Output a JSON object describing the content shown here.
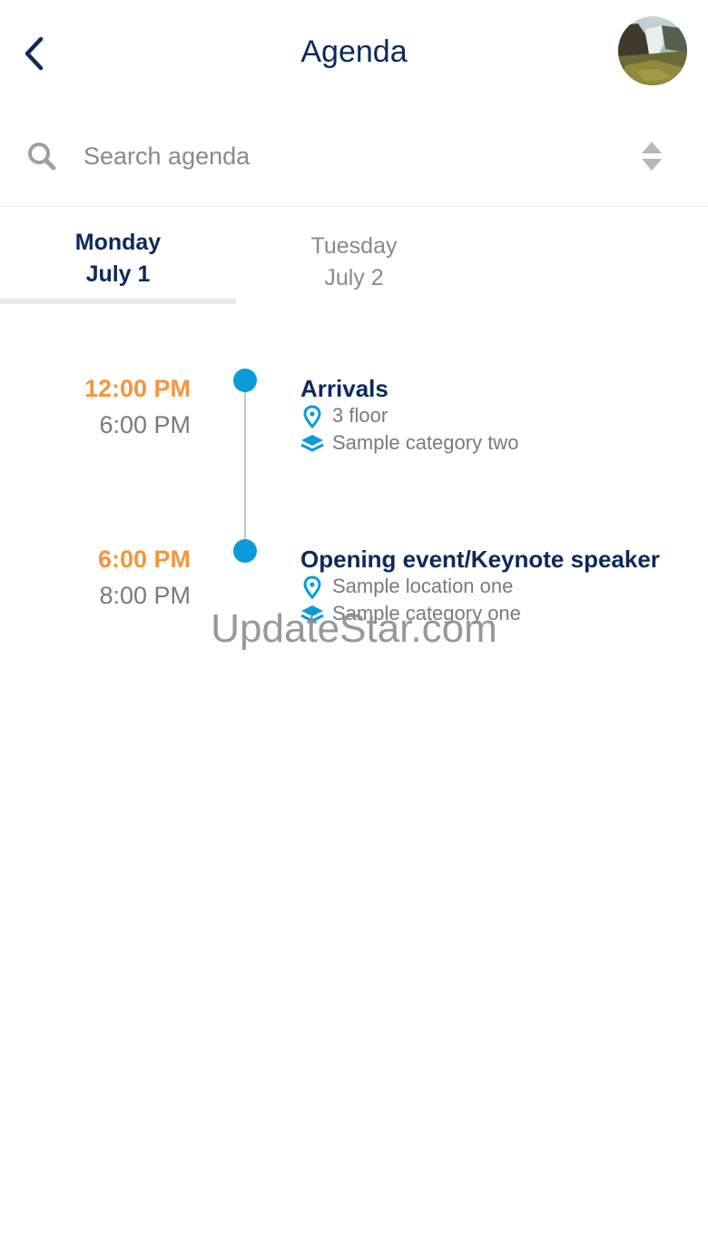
{
  "header": {
    "title": "Agenda",
    "accent_color": "#0b2a5c"
  },
  "search": {
    "placeholder": "Search agenda",
    "value": ""
  },
  "tabs": [
    {
      "day": "Monday",
      "date": "July 1",
      "active": true
    },
    {
      "day": "Tuesday",
      "date": "July 2",
      "active": false
    }
  ],
  "agenda": {
    "items": [
      {
        "start": "12:00 PM",
        "end": "6:00 PM",
        "title": "Arrivals",
        "location": "3 floor",
        "category": "Sample category two"
      },
      {
        "start": "6:00 PM",
        "end": "8:00 PM",
        "title": "Opening event/Keynote speaker",
        "location": "Sample location one",
        "category": "Sample category one"
      }
    ]
  },
  "watermark": {
    "text": "UpdateStar.com"
  },
  "colors": {
    "start_time": "#f4953e",
    "timeline_dot": "#0c9ad8",
    "icon": "#0c9ad8",
    "muted_text": "#7a7a7a"
  },
  "icons": {
    "back": "chevron-left-icon",
    "search": "search-icon",
    "sort": "sort-icon",
    "location": "location-pin-icon",
    "category": "layers-icon"
  }
}
